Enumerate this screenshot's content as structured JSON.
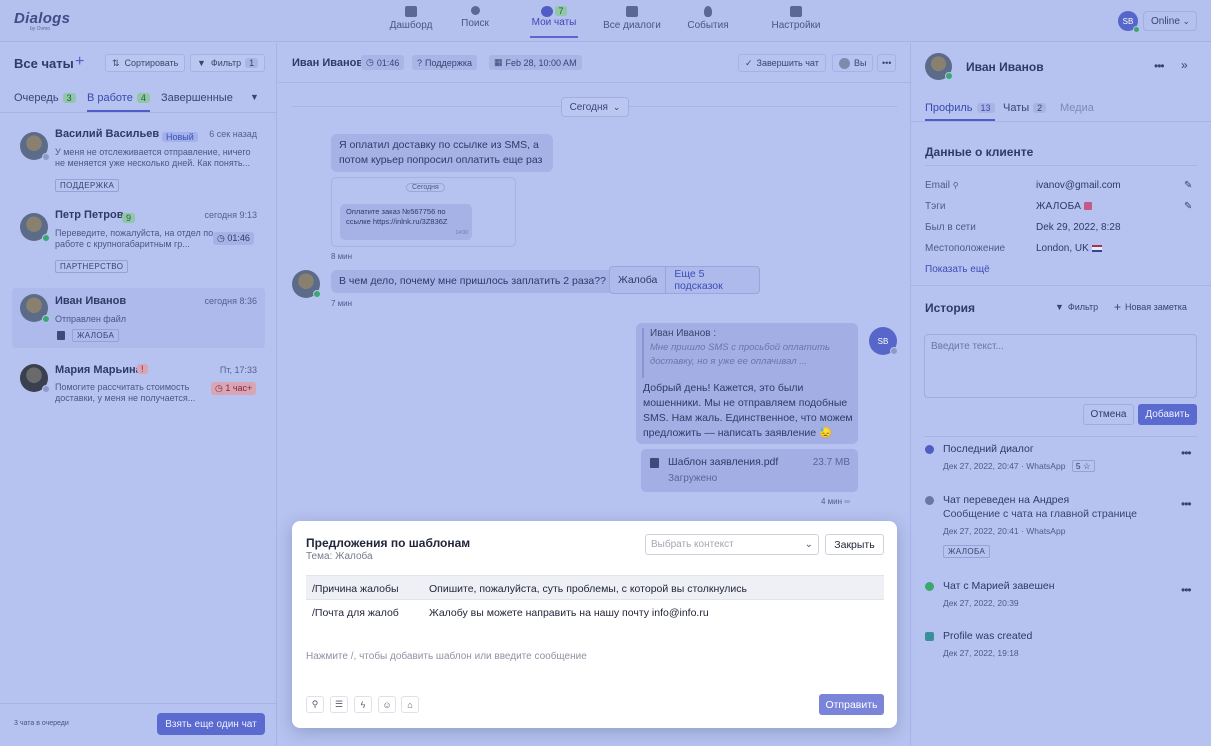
{
  "topbar": {
    "logo": "Dialogs",
    "logo_sub": "by Ovmo",
    "nav": [
      {
        "label": "Дашборд"
      },
      {
        "label": "Поиск"
      },
      {
        "label": "Мои чаты",
        "badge": "7"
      },
      {
        "label": "Все диалоги"
      },
      {
        "label": "События"
      },
      {
        "label": "Настройки"
      }
    ],
    "avatar": "SB",
    "status": "Online"
  },
  "left": {
    "title": "Все чаты",
    "sort": "Сортировать",
    "filter": "Фильтр",
    "filter_count": "1",
    "tabs": [
      {
        "label": "Очередь",
        "count": "3"
      },
      {
        "label": "В работе",
        "count": "4"
      },
      {
        "label": "Завершенные"
      }
    ],
    "chats": [
      {
        "name": "Василий Васильев",
        "badge": "Новый",
        "time": "6 сек назад",
        "text": "У меня не отслеживается отправление, ничего не меняется уже несколько дней. Как понять...",
        "tag": "ПОДДЕРЖКА"
      },
      {
        "name": "Петр Петров",
        "badge": "9",
        "time": "сегодня 9:13",
        "text": "Переведите, пожалуйста, на отдел по работе с крупногабаритным гр...",
        "timer": "01:46",
        "tag": "ПАРТНЕРСТВО"
      },
      {
        "name": "Иван Иванов",
        "time": "сегодня 8:36",
        "text": "Отправлен файл",
        "tag": "ЖАЛОБА"
      },
      {
        "name": "Мария Марьина",
        "badge": "!",
        "time": "Пт, 17:33",
        "text": "Помогите рассчитать стоимость доставки, у меня не получается...",
        "timer": "1 час+"
      }
    ],
    "queue_info": "3 чата в очереди",
    "take_more": "Взять еще один чат"
  },
  "center": {
    "name": "Иван Иванов",
    "timer": "01:46",
    "dept": "Поддержка",
    "date": "Feb 28, 10:00 AM",
    "finish": "Завершить чат",
    "you": "Вы",
    "today": "Сегодня",
    "msg1": "Я оплатил доставку по ссылке из SMS, а потом курьер попросил оплатить еще раз",
    "sms_today": "Сегодня",
    "sms_text": "Оплатите заказ №567756 по ссылке https://inlnk.ru/3Z836Z",
    "sms_time": "14:00",
    "t1": "8 мин",
    "msg2": "В чем дело, почему мне пришлось заплатить 2 раза??",
    "hint1": "Жалоба",
    "hint2": "Еще 5 подсказок",
    "t2": "7 мин",
    "reply_author": "Иван Иванов",
    "reply_quote": "Мне пришло SMS с просьбой оплатить доставку, но я уже ее оплачивал ...",
    "reply_text": "Добрый день! Кажется, это были мошенники. Мы не отправляем подобные SMS. Нам жаль. Единственное, что можем предложить — написать заявление 😓",
    "agent_avatar": "SB",
    "file_name": "Шаблон заявления.pdf",
    "file_size": "23.7 MB",
    "file_status": "Загружено",
    "t3": "4 мин"
  },
  "modal": {
    "title": "Предложения по шаблонам",
    "subtitle": "Тема: Жалоба",
    "select_placeholder": "Выбрать контекст",
    "close": "Закрыть",
    "rows": [
      {
        "key": "/Причина жалобы",
        "value": "Опишите, пожалуйста, суть проблемы, с которой вы столкнулись"
      },
      {
        "key": "/Почта для жалоб",
        "value": "Жалобу вы можете направить на нашу почту info@info.ru"
      }
    ],
    "input_placeholder": "Нажмите /, чтобы добавить шаблон или введите сообщение",
    "send": "Отправить"
  },
  "right": {
    "name": "Иван Иванов",
    "tabs": [
      {
        "label": "Профиль",
        "count": "13"
      },
      {
        "label": "Чаты",
        "count": "2"
      },
      {
        "label": "Медиа"
      }
    ],
    "section": "Данные о клиенте",
    "fields": [
      {
        "label": "Email",
        "value": "ivanov@gmail.com"
      },
      {
        "label": "Тэги",
        "value": "ЖАЛОБА"
      },
      {
        "label": "Был в сети",
        "value": "Dek 29, 2022, 8:28"
      },
      {
        "label": "Местоположение",
        "value": "London, UK"
      }
    ],
    "show_more": "Показать ещё",
    "history": "История",
    "filter": "Фильтр",
    "new_note": "Новая заметка",
    "note_placeholder": "Введите текст...",
    "cancel": "Отмена",
    "add": "Добавить",
    "events": [
      {
        "title": "Последний диалог",
        "meta": "Дек 27, 2022, 20:47",
        "source": "WhatsApp",
        "rating": "5 ☆"
      },
      {
        "title": "Чат переведен на Андрея",
        "subtitle": "Сообщение с чата на главной странице",
        "meta": "Дек 27, 2022, 20:41",
        "source": "WhatsApp",
        "tag": "ЖАЛОБА"
      },
      {
        "title": "Чат с Марией завешен",
        "meta": "Дек 27, 2022, 20:39"
      },
      {
        "title": "Profile was created",
        "meta": "Дек 27, 2022, 19:18"
      }
    ]
  }
}
